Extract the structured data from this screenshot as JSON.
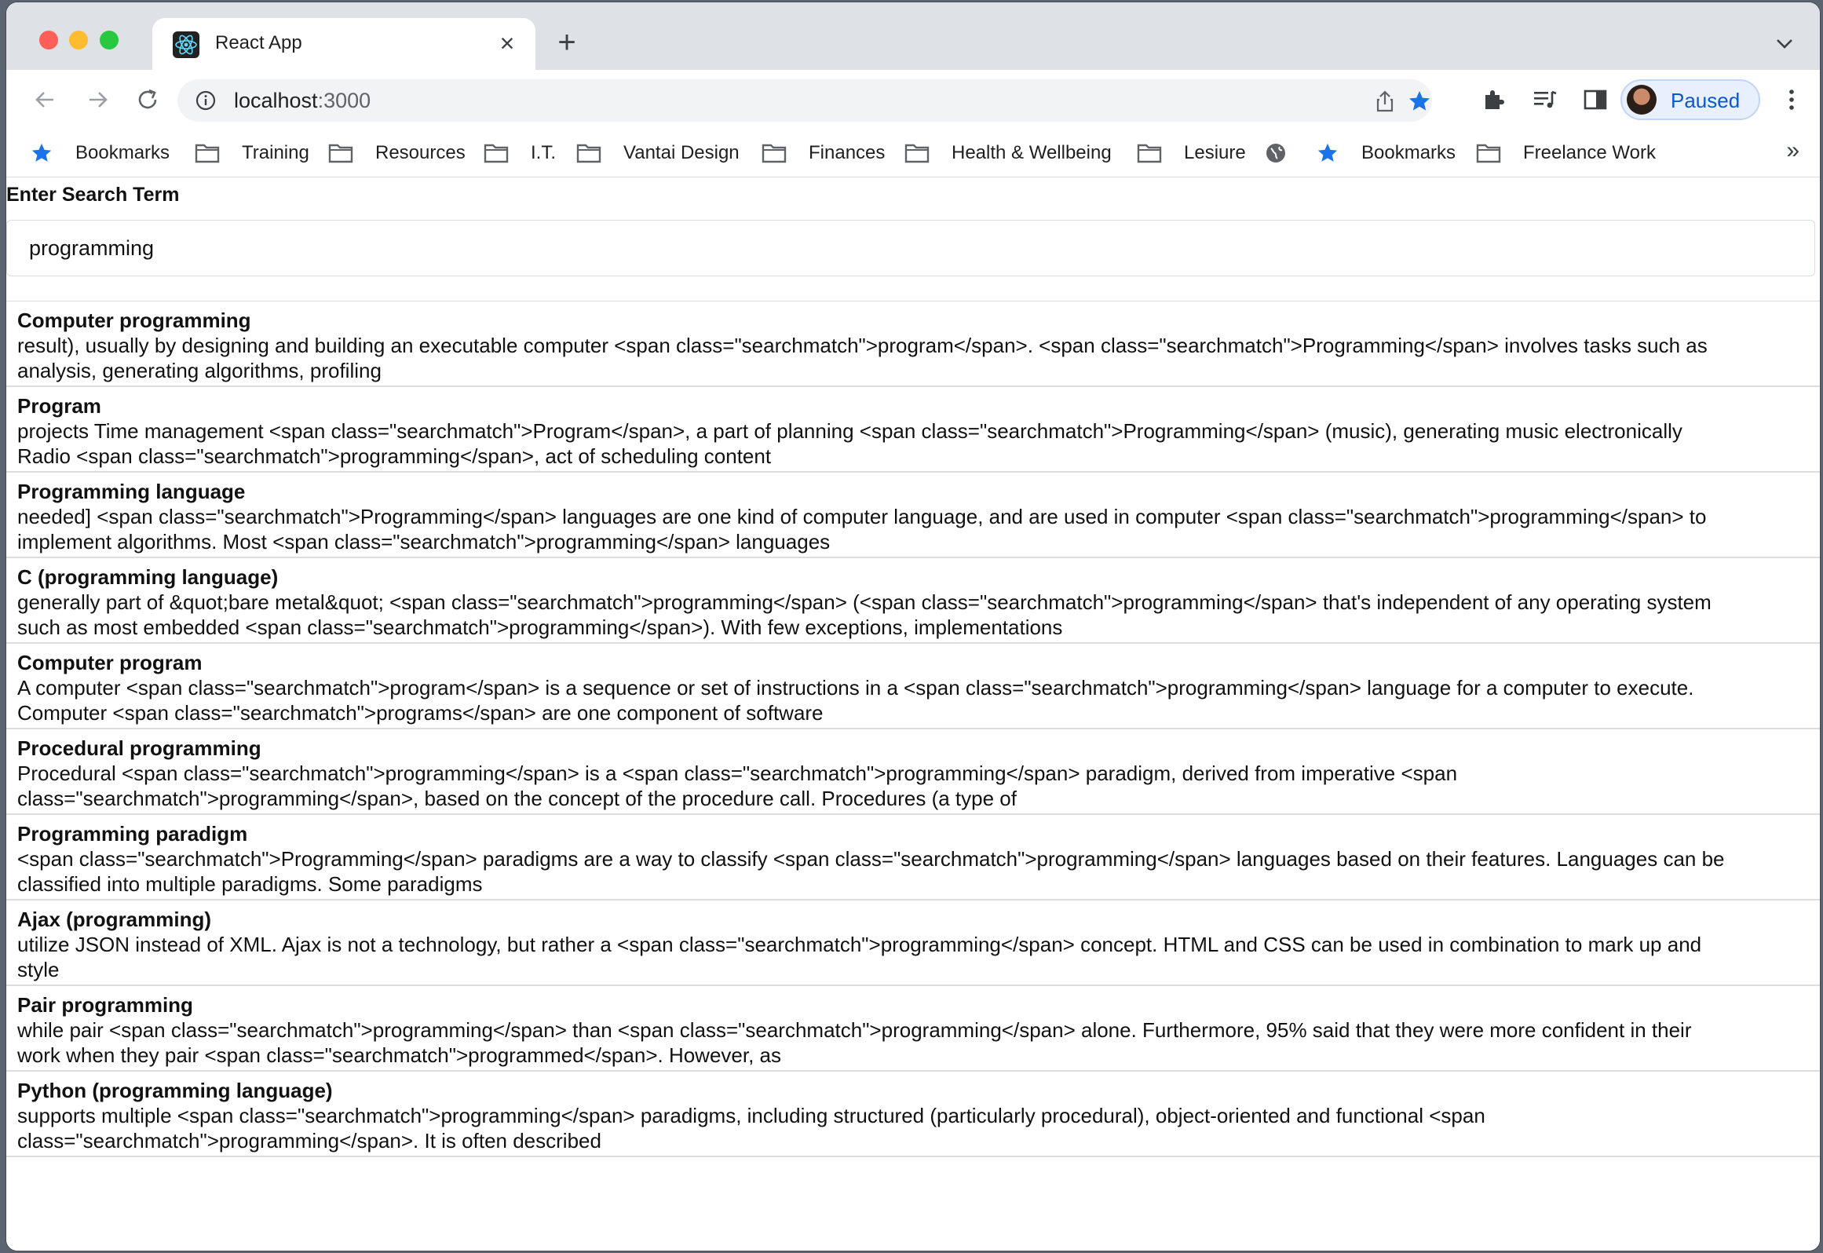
{
  "browser": {
    "tab_title": "React App",
    "url_host": "localhost",
    "url_port": ":3000",
    "profile_label": "Paused",
    "bookmarks": [
      {
        "label": "Bookmarks",
        "icon": "star-icon"
      },
      {
        "label": "Training",
        "icon": "folder-icon"
      },
      {
        "label": "Resources",
        "icon": "folder-icon"
      },
      {
        "label": "I.T.",
        "icon": "folder-icon"
      },
      {
        "label": "Vantai Design",
        "icon": "folder-icon"
      },
      {
        "label": "Finances",
        "icon": "folder-icon"
      },
      {
        "label": "Health & Wellbeing",
        "icon": "folder-icon"
      },
      {
        "label": "Lesiure",
        "icon": "folder-icon"
      },
      {
        "label": "",
        "icon": "globe-icon"
      },
      {
        "label": "Bookmarks",
        "icon": "star-icon"
      },
      {
        "label": "Freelance Work",
        "icon": "folder-icon"
      }
    ],
    "bookmarks_overflow": "»",
    "accent_color": "#0b57d0"
  },
  "search": {
    "label": "Enter Search Term",
    "value": "programming"
  },
  "results": [
    {
      "title": "Computer programming",
      "snippet_1": "result), usually by designing and building an executable computer <span class=\"searchmatch\">program</span>. <span class=\"searchmatch\">Programming</span> involves tasks such as",
      "snippet_2": "analysis, generating algorithms, profiling"
    },
    {
      "title": "Program",
      "snippet_1": "projects Time management <span class=\"searchmatch\">Program</span>, a part of planning <span class=\"searchmatch\">Programming</span> (music), generating music electronically",
      "snippet_2": "Radio <span class=\"searchmatch\">programming</span>, act of scheduling content"
    },
    {
      "title": "Programming language",
      "snippet_1": "needed] <span class=\"searchmatch\">Programming</span> languages are one kind of computer language, and are used in computer <span class=\"searchmatch\">programming</span> to",
      "snippet_2": "implement algorithms. Most <span class=\"searchmatch\">programming</span> languages"
    },
    {
      "title": "C (programming language)",
      "snippet_1": "generally part of &quot;bare metal&quot; <span class=\"searchmatch\">programming</span> (<span class=\"searchmatch\">programming</span> that's independent of any operating system",
      "snippet_2": "such as most embedded <span class=\"searchmatch\">programming</span>). With few exceptions, implementations"
    },
    {
      "title": "Computer program",
      "snippet_1": "A computer <span class=\"searchmatch\">program</span> is a sequence or set of instructions in a <span class=\"searchmatch\">programming</span> language for a computer to execute.",
      "snippet_2": "Computer <span class=\"searchmatch\">programs</span> are one component of software"
    },
    {
      "title": "Procedural programming",
      "snippet_1": "Procedural <span class=\"searchmatch\">programming</span> is a <span class=\"searchmatch\">programming</span> paradigm, derived from imperative <span",
      "snippet_2": "class=\"searchmatch\">programming</span>, based on the concept of the procedure call. Procedures (a type of"
    },
    {
      "title": "Programming paradigm",
      "snippet_1": "<span class=\"searchmatch\">Programming</span> paradigms are a way to classify <span class=\"searchmatch\">programming</span> languages based on their features. Languages can be",
      "snippet_2": "classified into multiple paradigms. Some paradigms"
    },
    {
      "title": "Ajax (programming)",
      "snippet_1": "utilize JSON instead of XML. Ajax is not a technology, but rather a <span class=\"searchmatch\">programming</span> concept. HTML and CSS can be used in combination to mark up and",
      "snippet_2": "style"
    },
    {
      "title": "Pair programming",
      "snippet_1": "while pair <span class=\"searchmatch\">programming</span> than <span class=\"searchmatch\">programming</span> alone. Furthermore, 95% said that they were more confident in their",
      "snippet_2": "work when they pair <span class=\"searchmatch\">programmed</span>. However, as"
    },
    {
      "title": "Python (programming language)",
      "snippet_1": "supports multiple <span class=\"searchmatch\">programming</span> paradigms, including structured (particularly procedural), object-oriented and functional <span",
      "snippet_2": "class=\"searchmatch\">programming</span>. It is often described"
    }
  ]
}
